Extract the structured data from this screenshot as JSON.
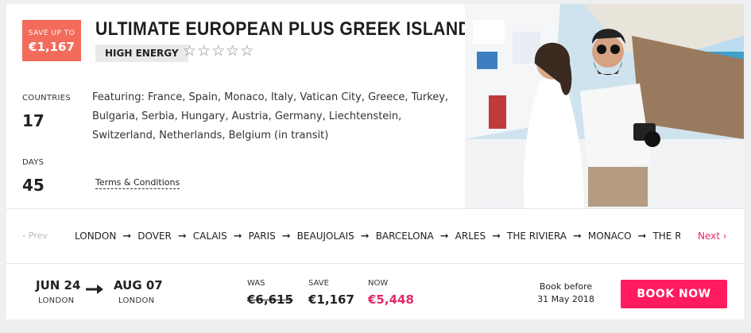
{
  "tour": {
    "save_label": "SAVE UP TO",
    "save_amount": "€1,167",
    "title": "ULTIMATE EUROPEAN PLUS GREEK ISLANDS",
    "tag": "HIGH ENERGY",
    "rating": {
      "value": 0,
      "max": 5,
      "icon": "star-outline-icon"
    },
    "countries_label": "COUNTRIES",
    "countries_value": "17",
    "days_label": "DAYS",
    "days_value": "45",
    "featuring": "Featuring: France, Spain, Monaco, Italy, Vatican City, Greece, Turkey, Bulgaria, Serbia, Hungary, Austria, Germany, Liechtenstein, Switzerland, Netherlands, Belgium (in transit)",
    "terms": "Terms & Conditions"
  },
  "route": {
    "prev_label": "‹ Prev",
    "next_label": "Next ›",
    "stops": [
      "LONDON",
      "DOVER",
      "CALAIS",
      "PARIS",
      "BEAUJOLAIS",
      "BARCELONA",
      "ARLES",
      "THE RIVIERA",
      "MONACO",
      "THE RIVIERA"
    ]
  },
  "dates": {
    "start_date": "JUN 24",
    "start_city": "LONDON",
    "end_date": "AUG 07",
    "end_city": "LONDON"
  },
  "pricing": {
    "was_label": "WAS",
    "was_value": "€6,615",
    "save_label": "SAVE",
    "save_value": "€1,167",
    "now_label": "NOW",
    "now_value": "€5,448",
    "book_before_line1": "Book before",
    "book_before_line2": "31 May 2018",
    "book_button": "BOOK NOW"
  },
  "colors": {
    "accent": "#ff1b5e",
    "badge": "#f26b5b",
    "now_price": "#e5296b"
  }
}
